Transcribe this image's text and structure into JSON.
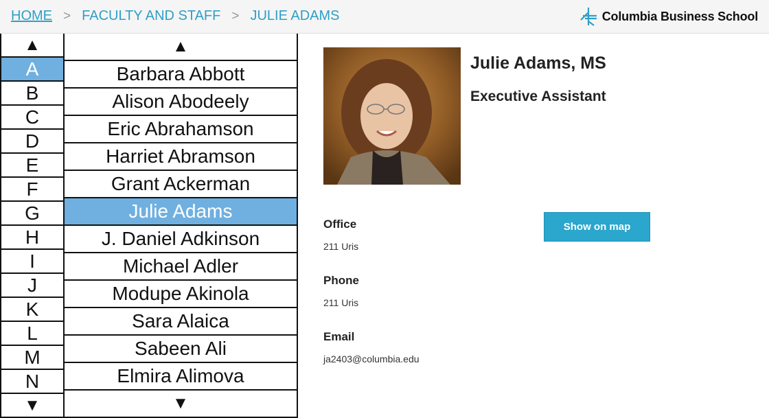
{
  "breadcrumb": {
    "home": "HOME",
    "sep1": ">",
    "section": "FACULTY AND STAFF",
    "sep2": ">",
    "current": "JULIE ADAMS"
  },
  "brand": {
    "name": "Columbia Business School",
    "color": "#2e9fc7"
  },
  "letters": {
    "up_icon": "▲",
    "down_icon": "▼",
    "items": [
      "A",
      "B",
      "C",
      "D",
      "E",
      "F",
      "G",
      "H",
      "I",
      "J",
      "K",
      "L",
      "M",
      "N"
    ],
    "selected": "A"
  },
  "names": {
    "up_icon": "▲",
    "down_icon": "▼",
    "items": [
      "Barbara Abbott",
      "Alison Abodeely",
      "Eric Abrahamson",
      "Harriet Abramson",
      "Grant Ackerman",
      "Julie Adams",
      "J. Daniel Adkinson",
      "Michael Adler",
      "Modupe Akinola",
      "Sara Alaica",
      "Sabeen Ali",
      "Elmira Alimova"
    ],
    "selected": "Julie Adams"
  },
  "profile": {
    "name": "Julie Adams, MS",
    "title": "Executive Assistant",
    "office_label": "Office",
    "office_value": "211 Uris",
    "phone_label": "Phone",
    "phone_value": "211 Uris",
    "email_label": "Email",
    "email_value": "ja2403@columbia.edu",
    "map_button": "Show on map"
  },
  "colors": {
    "accent": "#2ba6cd",
    "selection": "#6fb0e0",
    "link": "#2e9fc7"
  }
}
